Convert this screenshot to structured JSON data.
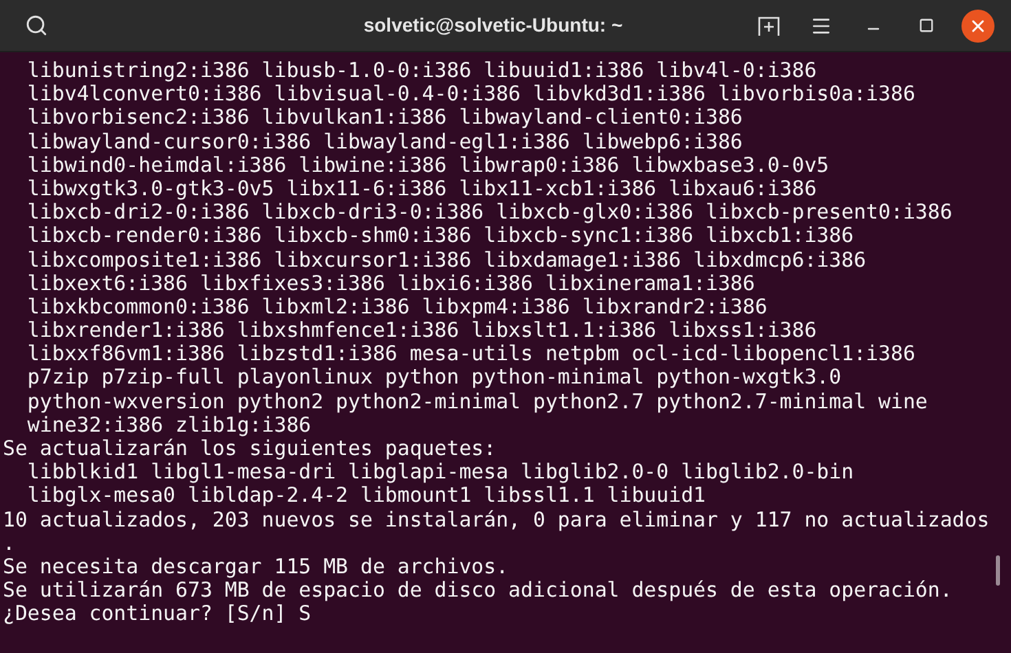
{
  "window": {
    "title": "solvetic@solvetic-Ubuntu: ~"
  },
  "terminal": {
    "lines": [
      "  libunistring2:i386 libusb-1.0-0:i386 libuuid1:i386 libv4l-0:i386",
      "  libv4lconvert0:i386 libvisual-0.4-0:i386 libvkd3d1:i386 libvorbis0a:i386",
      "  libvorbisenc2:i386 libvulkan1:i386 libwayland-client0:i386",
      "  libwayland-cursor0:i386 libwayland-egl1:i386 libwebp6:i386",
      "  libwind0-heimdal:i386 libwine:i386 libwrap0:i386 libwxbase3.0-0v5",
      "  libwxgtk3.0-gtk3-0v5 libx11-6:i386 libx11-xcb1:i386 libxau6:i386",
      "  libxcb-dri2-0:i386 libxcb-dri3-0:i386 libxcb-glx0:i386 libxcb-present0:i386",
      "  libxcb-render0:i386 libxcb-shm0:i386 libxcb-sync1:i386 libxcb1:i386",
      "  libxcomposite1:i386 libxcursor1:i386 libxdamage1:i386 libxdmcp6:i386",
      "  libxext6:i386 libxfixes3:i386 libxi6:i386 libxinerama1:i386",
      "  libxkbcommon0:i386 libxml2:i386 libxpm4:i386 libxrandr2:i386",
      "  libxrender1:i386 libxshmfence1:i386 libxslt1.1:i386 libxss1:i386",
      "  libxxf86vm1:i386 libzstd1:i386 mesa-utils netpbm ocl-icd-libopencl1:i386",
      "  p7zip p7zip-full playonlinux python python-minimal python-wxgtk3.0",
      "  python-wxversion python2 python2-minimal python2.7 python2.7-minimal wine",
      "  wine32:i386 zlib1g:i386",
      "Se actualizarán los siguientes paquetes:",
      "  libblkid1 libgl1-mesa-dri libglapi-mesa libglib2.0-0 libglib2.0-bin",
      "  libglx-mesa0 libldap-2.4-2 libmount1 libssl1.1 libuuid1",
      "10 actualizados, 203 nuevos se instalarán, 0 para eliminar y 117 no actualizados",
      ".",
      "Se necesita descargar 115 MB de archivos.",
      "Se utilizarán 673 MB de espacio de disco adicional después de esta operación.",
      "¿Desea continuar? [S/n] S"
    ]
  }
}
